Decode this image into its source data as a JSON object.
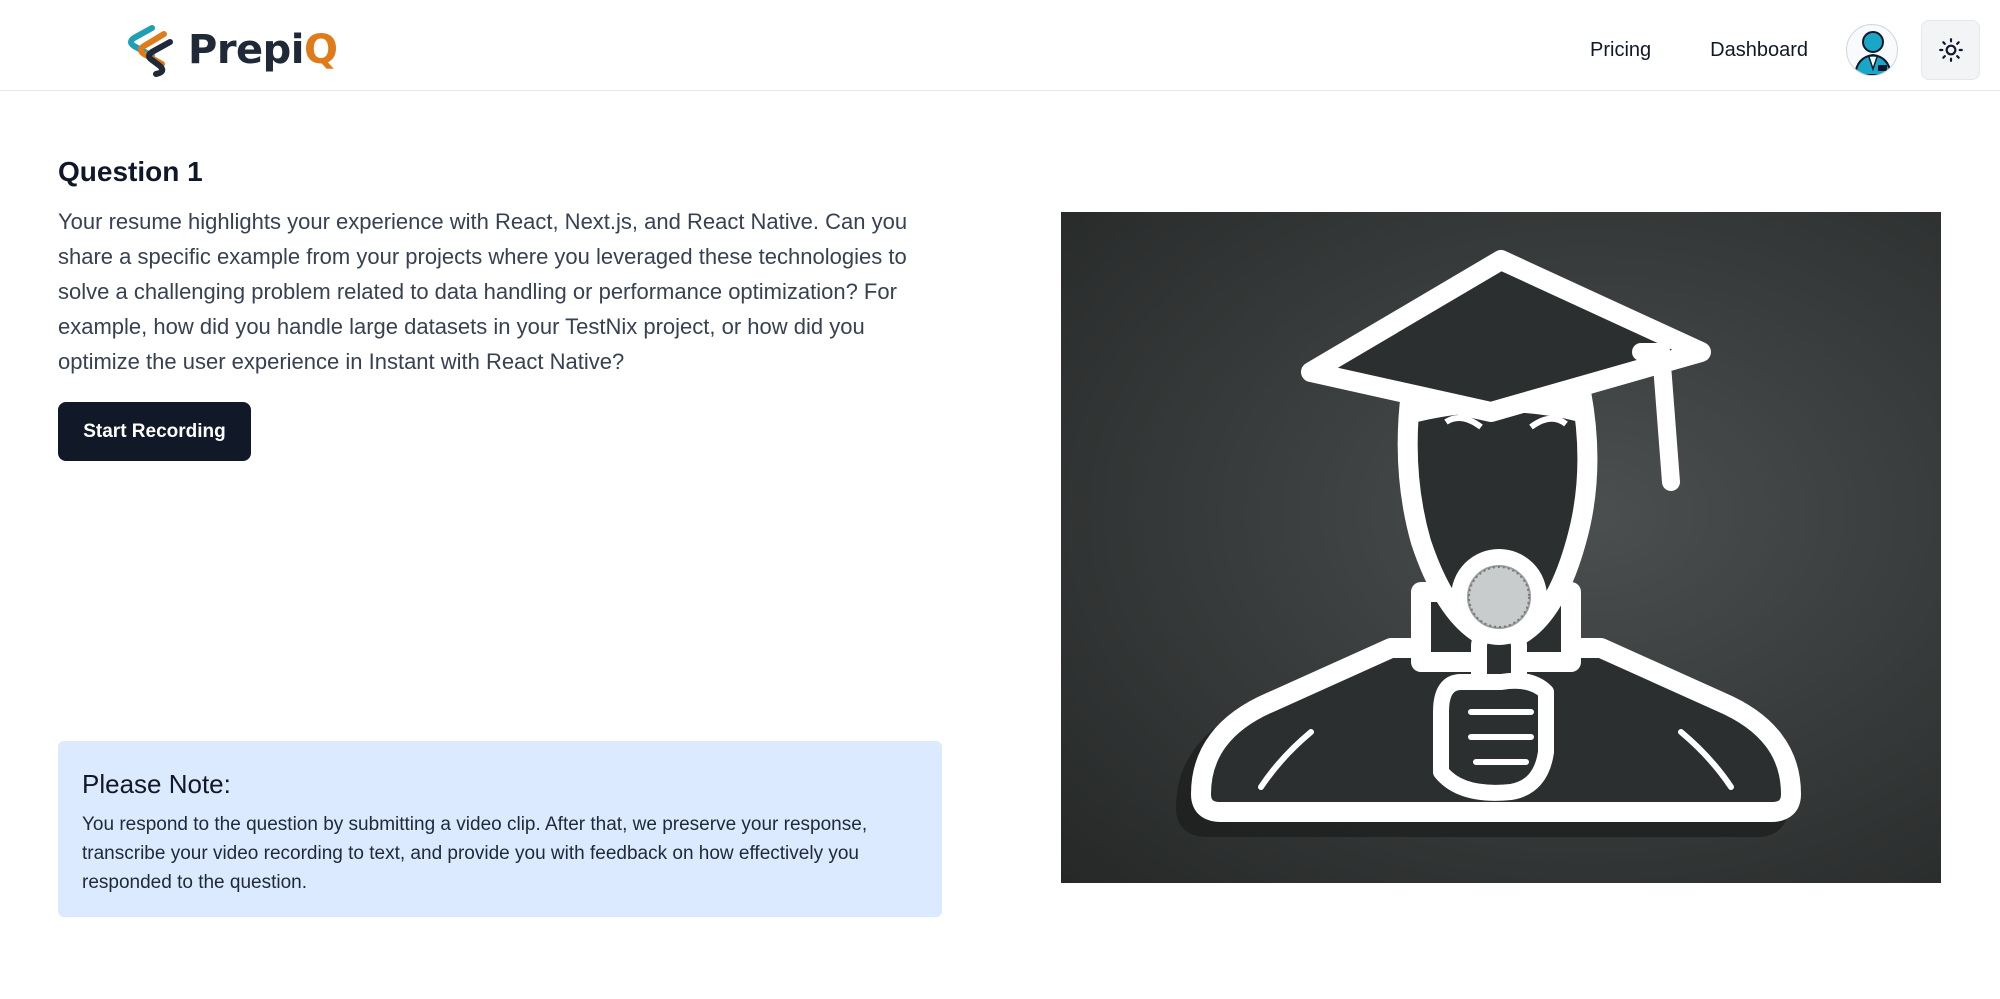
{
  "navbar": {
    "brand": {
      "name_main": "Prepi",
      "name_accent": "Q",
      "logo_icon": "prepiq-logo-icon"
    },
    "links": [
      {
        "label": "Pricing"
      },
      {
        "label": "Dashboard"
      }
    ],
    "avatar_icon": "user-avatar-icon",
    "theme_icon": "sun-icon"
  },
  "question": {
    "heading": "Question 1",
    "text": "Your resume highlights your experience with React, Next.js, and React Native. Can you share a specific example from your projects where you leveraged these technologies to solve a challenging problem related to data handling or performance optimization? For example, how did you handle large datasets in your TestNix project, or how did you optimize the user experience in Instant with React Native?",
    "record_button": "Start Recording"
  },
  "note": {
    "title": "Please Note:",
    "text": "You respond to the question by submitting a video clip. After that, we preserve your response, transcribe your video recording to text, and provide you with feedback on how effectively you responded to the question."
  },
  "illustration": {
    "icon": "graduate-with-microphone-icon"
  },
  "colors": {
    "accent": "#e07b1a",
    "primary_button": "#111827",
    "note_background": "#dbeafe"
  }
}
